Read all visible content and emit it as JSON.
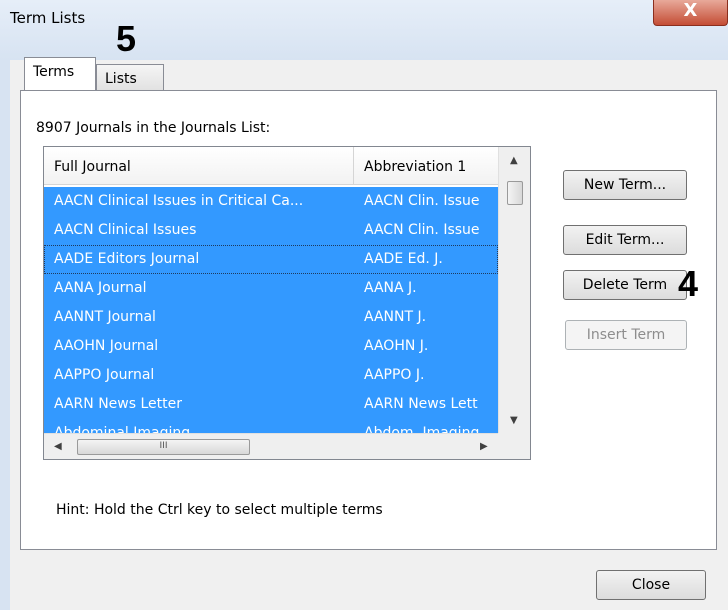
{
  "window": {
    "title": "Term Lists",
    "close_glyph": "X"
  },
  "annotations": {
    "label_5": "5",
    "label_4": "4"
  },
  "tabs": [
    {
      "label": "Terms",
      "active": true
    },
    {
      "label": "Lists",
      "active": false
    }
  ],
  "list_caption": "8907 Journals in the Journals List:",
  "table": {
    "columns": [
      "Full Journal",
      "Abbreviation 1"
    ],
    "rows": [
      {
        "full": "AACN Clinical Issues in Critical Ca...",
        "abbr": "AACN Clin. Issue"
      },
      {
        "full": "AACN Clinical Issues",
        "abbr": "AACN Clin. Issue"
      },
      {
        "full": "AADE Editors Journal",
        "abbr": "AADE Ed. J."
      },
      {
        "full": "AANA Journal",
        "abbr": "AANA J."
      },
      {
        "full": "AANNT Journal",
        "abbr": "AANNT J."
      },
      {
        "full": "AAOHN Journal",
        "abbr": "AAOHN J."
      },
      {
        "full": "AAPPO Journal",
        "abbr": "AAPPO J."
      },
      {
        "full": "AARN News Letter",
        "abbr": "AARN News Lett"
      },
      {
        "full": "Abdominal Imaging",
        "abbr": "Abdom. Imaging"
      }
    ],
    "hscroll_grip": "III"
  },
  "buttons": {
    "new_term": "New Term...",
    "edit_term": "Edit Term...",
    "delete_term": "Delete Term",
    "insert_term": "Insert Term",
    "close": "Close"
  },
  "hint": "Hint: Hold the Ctrl key to select multiple terms",
  "colors": {
    "selection": "#3399ff",
    "title_close": "#c44d35"
  }
}
